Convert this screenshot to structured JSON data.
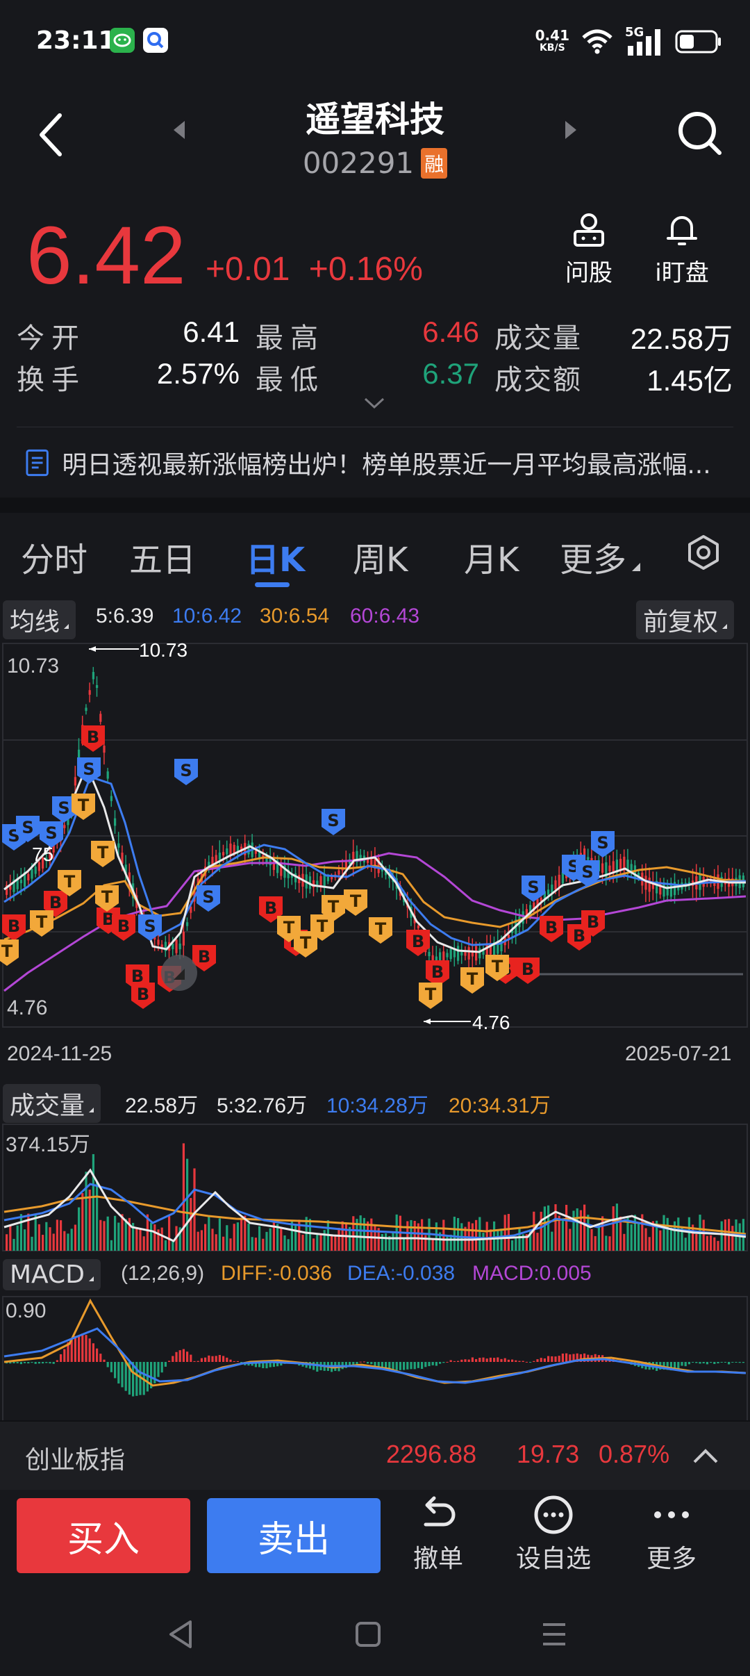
{
  "status_bar": {
    "time": "23:11",
    "net_speed_value": "0.41",
    "net_speed_unit": "KB/S",
    "signal_label": "5G",
    "icons": [
      "wechat-app-icon",
      "search-app-icon",
      "wifi-icon",
      "signal-icon",
      "battery-icon"
    ]
  },
  "header": {
    "stock_name": "遥望科技",
    "stock_code": "002291",
    "margin_badge": "融"
  },
  "quote": {
    "last_price": "6.42",
    "change": "+0.01",
    "change_pct": "+0.16%",
    "ask_label": "问股",
    "watch_label": "i盯盘",
    "open_label": "今开",
    "open_value": "6.41",
    "high_label": "最高",
    "high_value": "6.46",
    "volume_label": "成交量",
    "volume_value": "22.58万",
    "turnover_label": "换手",
    "turnover_value": "2.57%",
    "low_label": "最低",
    "low_value": "6.37",
    "amount_label": "成交额",
    "amount_value": "1.45亿"
  },
  "news": {
    "headline": "明日透视最新涨幅榜出炉！榜单股票近一月平均最高涨幅..."
  },
  "tabs": {
    "items": [
      "分时",
      "五日",
      "日K",
      "周K",
      "月K",
      "更多"
    ],
    "active": "日K"
  },
  "kline": {
    "ma_chip": "均线",
    "ma5": "5:6.39",
    "ma10": "10:6.42",
    "ma30": "30:6.54",
    "ma60": "60:6.43",
    "adjust_chip": "前复权",
    "y_max_label": "10.73",
    "y_min_label": "4.76",
    "high_marker": "10.73",
    "low_marker": "4.76",
    "partial_label": "75",
    "date_start": "2024-11-25",
    "date_end": "2025-07-21",
    "colors": {
      "up": "#e8383d",
      "down": "#1fa37a",
      "ma5": "#e9e9ea",
      "ma10": "#3d7cf0",
      "ma30": "#e89a2c",
      "ma60": "#b447d6"
    }
  },
  "volume": {
    "chip": "成交量",
    "current": "22.58万",
    "ma5": "5:32.76万",
    "ma10": "10:34.28万",
    "ma20": "20:34.31万",
    "y_max_label": "374.15万"
  },
  "macd": {
    "chip": "MACD",
    "params": "(12,26,9)",
    "diff": "DIFF:-0.036",
    "dea": "DEA:-0.038",
    "macd": "MACD:0.005",
    "y_max_label": "0.90"
  },
  "index_ticker": {
    "name": "创业板指",
    "value": "2296.88",
    "change": "19.73",
    "change_pct": "0.87%"
  },
  "actions": {
    "buy": "买入",
    "sell": "卖出",
    "cancel": "撤单",
    "watchlist": "设自选",
    "more": "更多"
  }
}
